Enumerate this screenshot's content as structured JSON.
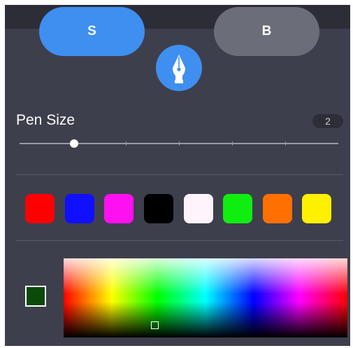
{
  "mode_buttons": [
    {
      "label": "S",
      "selected": true
    },
    {
      "label": "B",
      "selected": false
    }
  ],
  "tool": {
    "icon": "pen-nib-icon"
  },
  "pen_size": {
    "label": "Pen Size",
    "value": "2"
  },
  "slider": {
    "value": 2,
    "fraction": 0.17
  },
  "swatches": [
    "#ff0000",
    "#1010ff",
    "#ff10f0",
    "#000000",
    "#fff4fb",
    "#10ee10",
    "#ff7000",
    "#fff000"
  ],
  "current_color": "#0b4a0b",
  "colors": {
    "accent": "#3f8ff0",
    "panel": "#3e3f4d",
    "button_inactive": "#6b6d78"
  }
}
